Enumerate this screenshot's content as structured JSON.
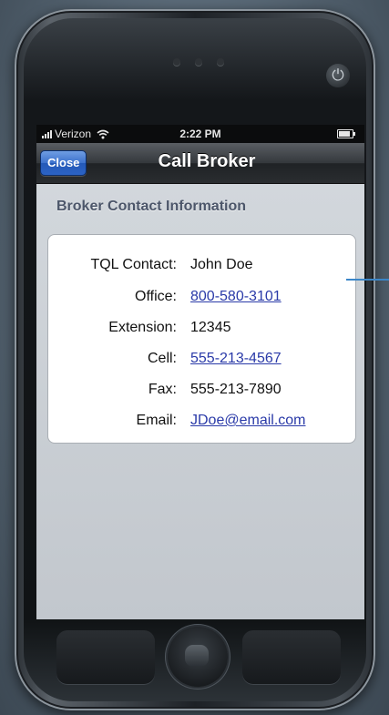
{
  "status_bar": {
    "carrier": "Verizon",
    "time": "2:22 PM"
  },
  "nav_bar": {
    "close_label": "Close",
    "title": "Call Broker"
  },
  "section": {
    "title": "Broker Contact Information"
  },
  "contact": {
    "rows": [
      {
        "label": "TQL Contact:",
        "value": "John Doe",
        "is_link": false
      },
      {
        "label": "Office:",
        "value": "800-580-3101",
        "is_link": true
      },
      {
        "label": "Extension:",
        "value": "12345",
        "is_link": false
      },
      {
        "label": "Cell:",
        "value": "555-213-4567",
        "is_link": true
      },
      {
        "label": "Fax:",
        "value": "555-213-7890",
        "is_link": false
      },
      {
        "label": "Email:",
        "value": "JDoe@email.com",
        "is_link": true
      }
    ]
  },
  "colors": {
    "nav_button_blue": "#2c63c4",
    "link_blue": "#2a3aa8",
    "section_title": "#4c566a",
    "annotation_line": "#3b86c8"
  },
  "icons": [
    "signal-bars-icon",
    "wifi-icon",
    "battery-icon",
    "power-icon",
    "home-button-icon"
  ]
}
